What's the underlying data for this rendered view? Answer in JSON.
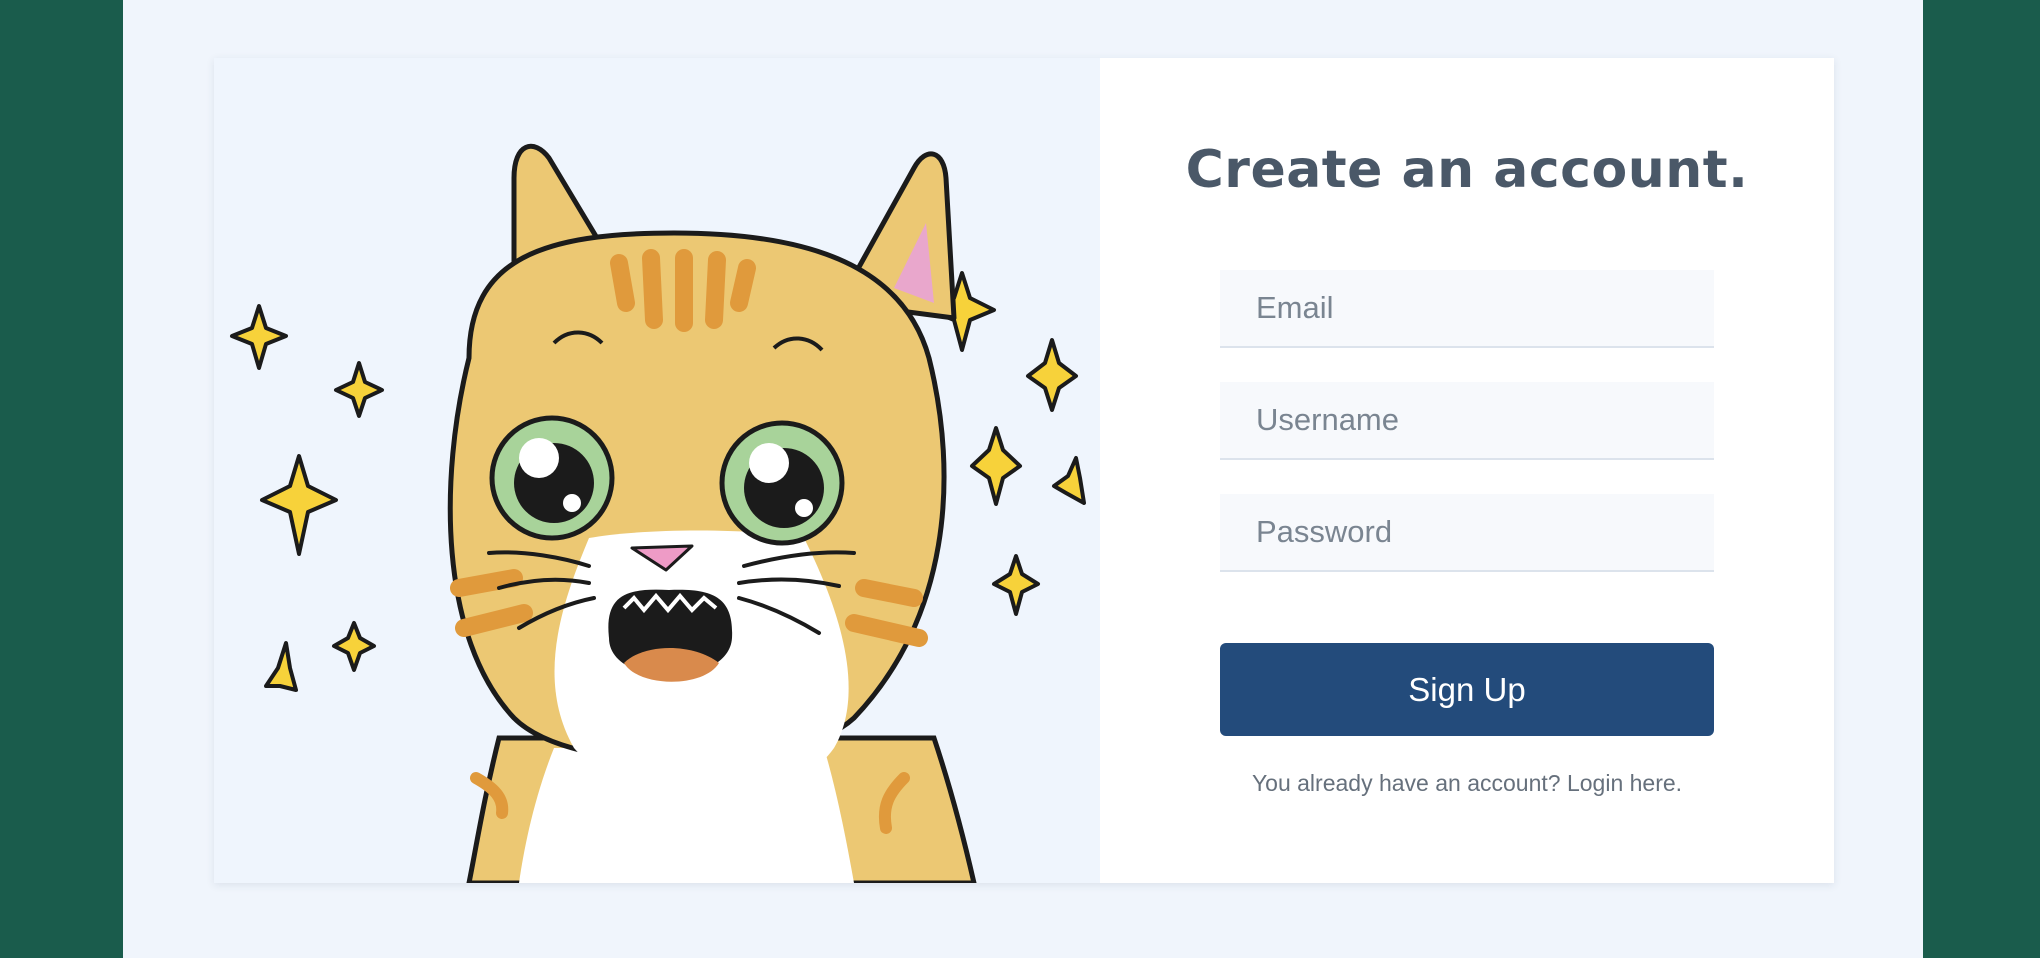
{
  "form": {
    "title": "Create an account.",
    "email_placeholder": "Email",
    "username_placeholder": "Username",
    "password_placeholder": "Password",
    "signup_label": "Sign Up",
    "login_prompt": "You already have an account?",
    "login_link": "Login here."
  },
  "colors": {
    "background": "#1a5c4c",
    "page": "#f0f5fc",
    "button": "#234b7b",
    "title": "#4a5868"
  },
  "illustration": {
    "icon": "surprised-cat-illustration"
  }
}
